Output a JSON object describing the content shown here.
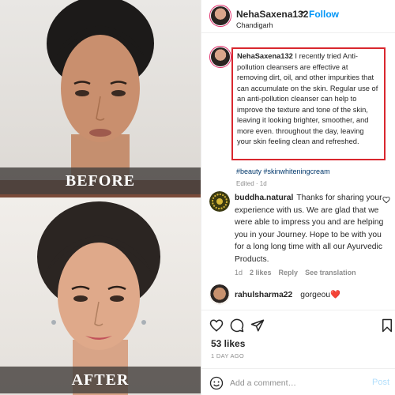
{
  "media": {
    "before_label": "BEFORE",
    "after_label": "AFTER"
  },
  "header": {
    "username": "NehaSaxena132",
    "separator": "•",
    "follow_label": "Follow",
    "location": "Chandigarh"
  },
  "caption": {
    "username": "NehaSaxena132",
    "text": "I recently tried Anti-pollution cleansers are effective at removing dirt, oil, and other impurities that can accumulate on the skin. Regular use of an anti-pollution cleanser can help to improve the texture and tone of the skin, leaving it looking brighter, smoother, and more even. throughout the day, leaving your skin feeling clean and refreshed.",
    "highlight_color": "#d9272e",
    "hashtags": "#beauty #skinwhiteningcream",
    "edited": "Edited · 1d"
  },
  "comments": [
    {
      "username": "buddha.natural",
      "text": "Thanks for sharing your experience with us. We are glad that we were able to impress you and are helping you in your Journey. Hope to be with you for a long long time with all our Ayurvedic Products.",
      "time": "1d",
      "likes": "2 likes",
      "reply_label": "Reply",
      "see_translation_label": "See translation"
    },
    {
      "username": "rahulsharma22",
      "text": "gorgeou",
      "emoji": "❤️"
    }
  ],
  "actions": {
    "icons": [
      "heart-icon",
      "comment-icon",
      "share-icon",
      "bookmark-icon"
    ]
  },
  "likes": "53 likes",
  "posted": "1 DAY AGO",
  "add_comment": {
    "placeholder": "Add a comment…",
    "post_label": "Post",
    "emoji_icon": "smiley-icon"
  },
  "colors": {
    "link": "#0095f6",
    "hashtag": "#00376b",
    "story_ring": "#e1306c",
    "muted": "#8e8e8e"
  }
}
